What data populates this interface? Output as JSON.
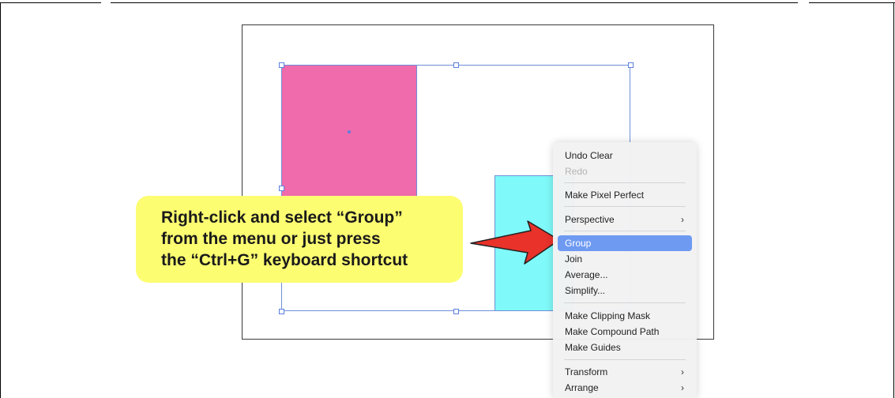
{
  "callout": {
    "lines": [
      "Right-click and select “Group”",
      "from the menu or just press",
      "the “Ctrl+G” keyboard shortcut"
    ]
  },
  "context_menu": {
    "items": [
      {
        "label": "Undo Clear",
        "state": "enabled"
      },
      {
        "label": "Redo",
        "state": "disabled"
      },
      {
        "label": "Make Pixel Perfect",
        "state": "enabled"
      },
      {
        "label": "Perspective",
        "state": "enabled",
        "submenu": true
      },
      {
        "label": "Group",
        "state": "highlighted"
      },
      {
        "label": "Join",
        "state": "enabled"
      },
      {
        "label": "Average...",
        "state": "enabled"
      },
      {
        "label": "Simplify...",
        "state": "enabled"
      },
      {
        "label": "Make Clipping Mask",
        "state": "enabled"
      },
      {
        "label": "Make Compound Path",
        "state": "enabled"
      },
      {
        "label": "Make Guides",
        "state": "enabled"
      },
      {
        "label": "Transform",
        "state": "enabled",
        "submenu": true
      },
      {
        "label": "Arrange",
        "state": "enabled",
        "submenu": true
      }
    ],
    "submenu_glyph": "›",
    "highlight_color": "#6e9af2"
  },
  "canvas": {
    "shapes": [
      {
        "name": "pink-rectangle",
        "fill": "#f06bab"
      },
      {
        "name": "cyan-rectangle",
        "fill": "#7ff9f9"
      }
    ],
    "selection_color": "#5b7fe0"
  },
  "colors": {
    "callout_fill": "#fdfd72",
    "arrow_fill": "#e8322a"
  },
  "icons": [
    "red-pointer-arrow-icon",
    "chevron-right-icon"
  ]
}
